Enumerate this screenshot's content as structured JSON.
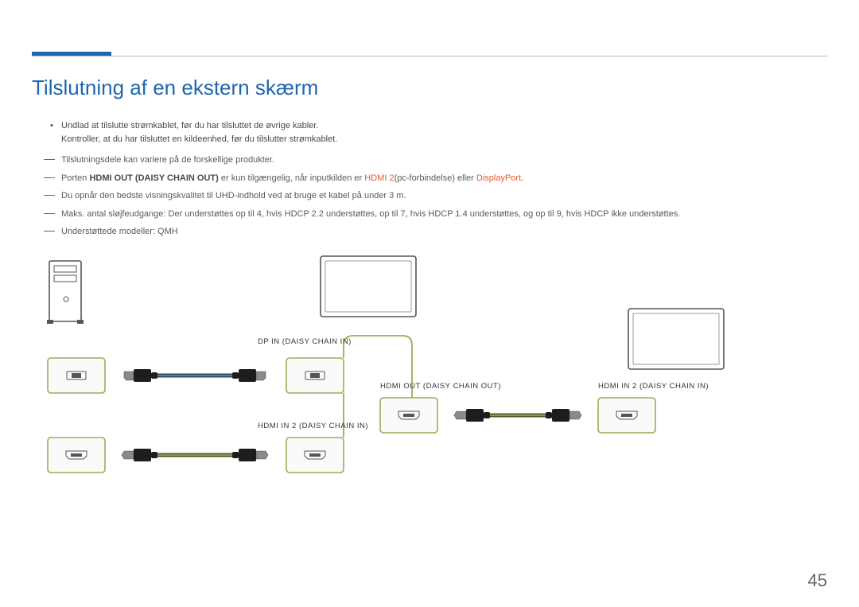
{
  "page_number": "45",
  "title": "Tilslutning af en ekstern skærm",
  "bullets": [
    "Undlad at tilslutte strømkablet, før du har tilsluttet de øvrige kabler.",
    "Kontroller, at du har tilsluttet en kildeenhed, før du tilslutter strømkablet."
  ],
  "dashes": [
    {
      "before": "Tilslutningsdele kan variere på de forskellige produkter."
    },
    {
      "before": "Porten ",
      "strong1": "HDMI OUT (DAISY CHAIN OUT)",
      "mid1": " er kun tilgængelig, når inputkilden er ",
      "warn1": "HDMI 2",
      "mid2": "(pc-forbindelse) eller ",
      "warn2": "DisplayPort",
      "after": "."
    },
    {
      "before": "Du opnår den bedste visningskvalitet til UHD-indhold ved at bruge et kabel på under 3 m."
    },
    {
      "before": "Maks. antal sløjfeudgange: Der understøttes op til 4, hvis HDCP 2.2 understøttes, op til 7, hvis HDCP 1.4 understøttes, og op til 9, hvis HDCP ikke understøttes."
    },
    {
      "before": "Understøttede modeller: QMH"
    }
  ],
  "diagram": {
    "labels": {
      "dp_in": "DP IN (DAISY CHAIN IN)",
      "hdmi_in2_left": "HDMI IN 2 (DAISY CHAIN IN)",
      "hdmi_out": "HDMI OUT (DAISY CHAIN OUT)",
      "hdmi_in2_right": "HDMI IN 2 (DAISY CHAIN IN)"
    }
  }
}
